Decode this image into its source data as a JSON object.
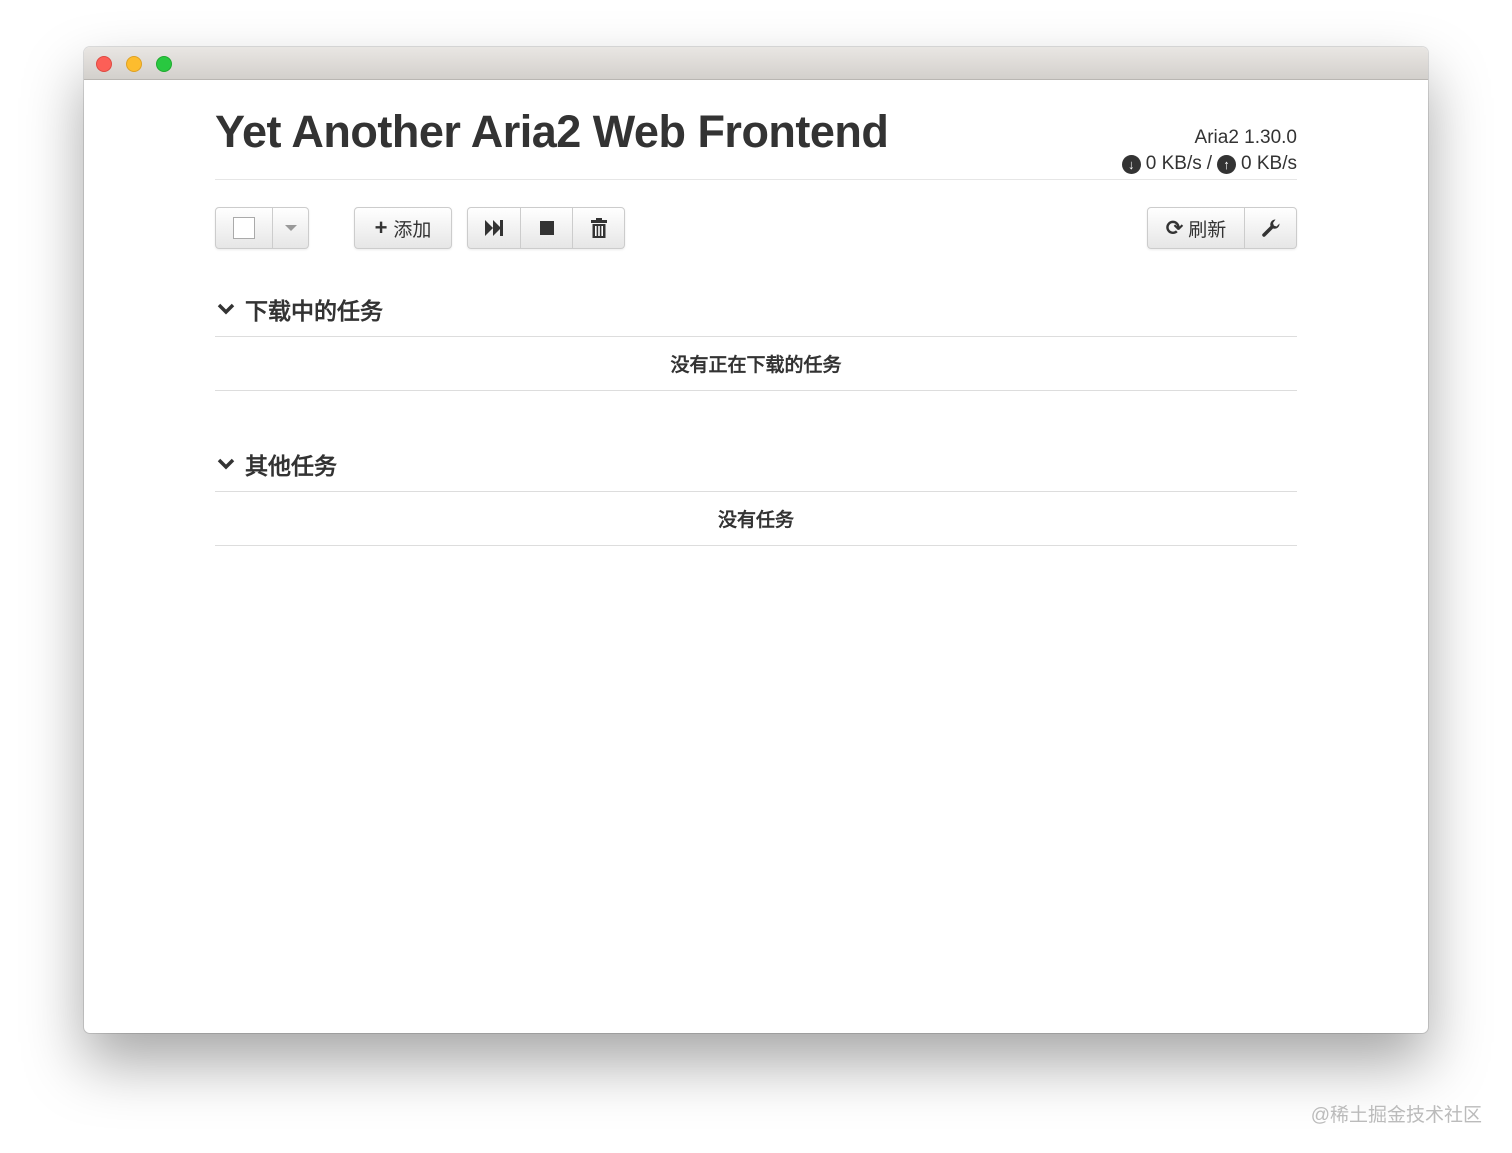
{
  "app": {
    "title": "Yet Another Aria2 Web Frontend",
    "version": "Aria2 1.30.0",
    "download_speed": "0 KB/s",
    "separator": "/",
    "upload_speed": "0 KB/s"
  },
  "toolbar": {
    "add_label": "添加",
    "refresh_label": "刷新"
  },
  "sections": [
    {
      "title": "下载中的任务",
      "empty_text": "没有正在下载的任务"
    },
    {
      "title": "其他任务",
      "empty_text": "没有任务"
    }
  ],
  "watermark": "@稀土掘金技术社区",
  "icons": [
    "download-icon",
    "upload-icon",
    "caret-down-icon",
    "plus-icon",
    "resume-icon",
    "stop-icon",
    "trash-icon",
    "refresh-icon",
    "wrench-icon",
    "chevron-down-icon"
  ]
}
